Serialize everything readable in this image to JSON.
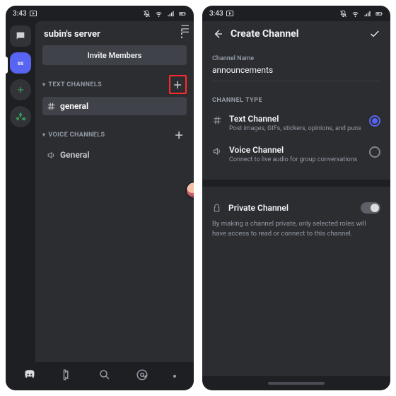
{
  "status": {
    "time": "3:43"
  },
  "screen1": {
    "server_title": "subin's server",
    "avatar_initials": "ss",
    "invite_label": "Invite Members",
    "categories": {
      "text": {
        "label": "TEXT CHANNELS",
        "channels": [
          {
            "name": "general"
          }
        ]
      },
      "voice": {
        "label": "VOICE CHANNELS",
        "channels": [
          {
            "name": "General"
          }
        ]
      }
    }
  },
  "screen2": {
    "title": "Create Channel",
    "channel_name_label": "Channel Name",
    "channel_name_value": "announcements",
    "type_section": "CHANNEL TYPE",
    "text_type": {
      "title": "Text Channel",
      "desc": "Post images, GIFs, stickers, opinions, and puns"
    },
    "voice_type": {
      "title": "Voice Channel",
      "desc": "Connect to live audio for group conversations"
    },
    "private": {
      "title": "Private Channel",
      "desc": "By making a channel private, only selected roles will have access to read or connect to this channel."
    }
  }
}
